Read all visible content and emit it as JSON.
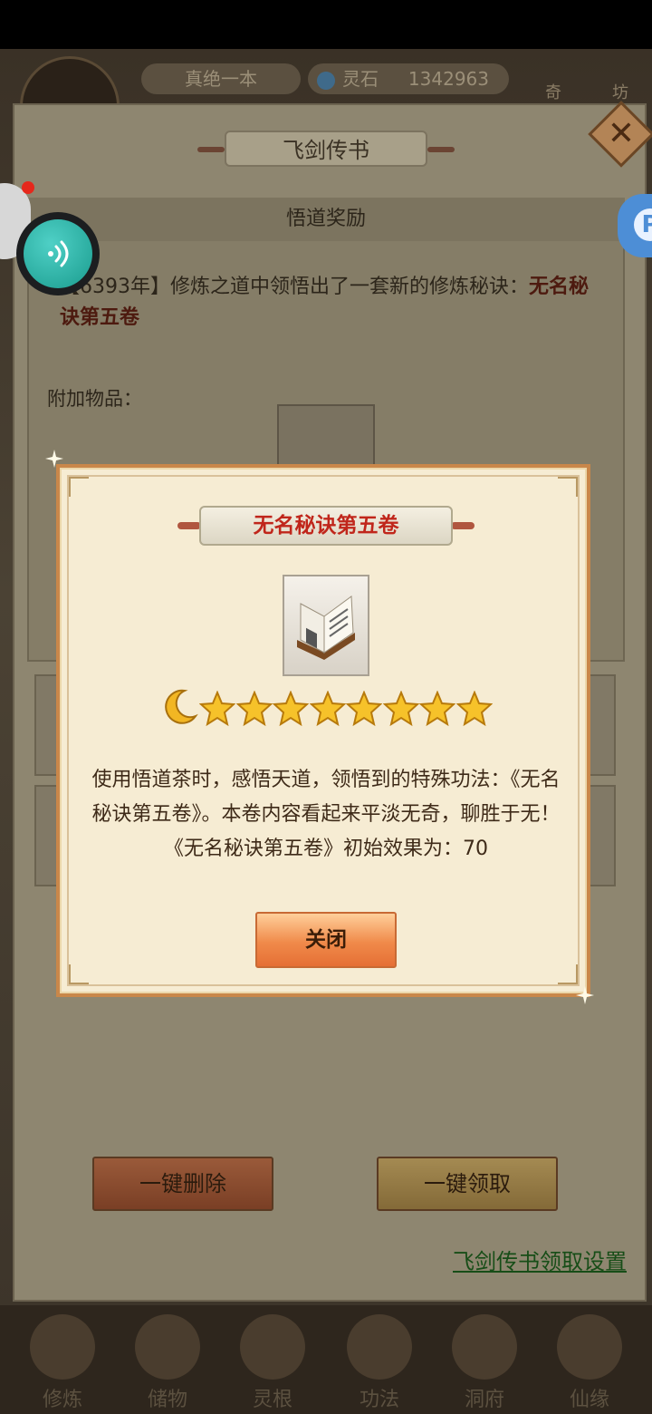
{
  "topbar": {
    "player_name": "真绝一本",
    "currency_label": "灵石",
    "currency_value": "1342963",
    "side_right_1": "奇",
    "side_right_2": "坊"
  },
  "panel": {
    "title": "飞剑传书",
    "section_header": "悟道奖励",
    "message_year": "【6393年】",
    "message_body": "修炼之道中领悟出了一套新的修炼秘诀：",
    "message_highlight": "无名秘诀第五卷",
    "attach_label": "附加物品：",
    "delete_all_label": "一键删除",
    "claim_all_label": "一键领取",
    "settings_link": "飞剑传书领取设置"
  },
  "nav": {
    "items": [
      {
        "label": "修炼",
        "icon": "cultivate-icon"
      },
      {
        "label": "储物",
        "icon": "storage-icon"
      },
      {
        "label": "灵根",
        "icon": "spirit-root-icon"
      },
      {
        "label": "功法",
        "icon": "technique-icon"
      },
      {
        "label": "洞府",
        "icon": "cave-icon"
      },
      {
        "label": "仙缘",
        "icon": "fate-icon"
      }
    ]
  },
  "modal": {
    "title": "无名秘诀第五卷",
    "item_icon": "book-icon",
    "rank": {
      "moons": 1,
      "stars": 8
    },
    "description": "使用悟道茶时，感悟天道，领悟到的特殊功法：《无名秘诀第五卷》。本卷内容看起来平淡无奇，聊胜于无！《无名秘诀第五卷》初始效果为：70",
    "close_label": "关闭"
  },
  "colors": {
    "modal_bg": "#f6ecd3",
    "modal_border": "#c9874a",
    "title_red": "#c0261b",
    "button_orange": "#f08a4a",
    "link_green": "#174d17"
  }
}
